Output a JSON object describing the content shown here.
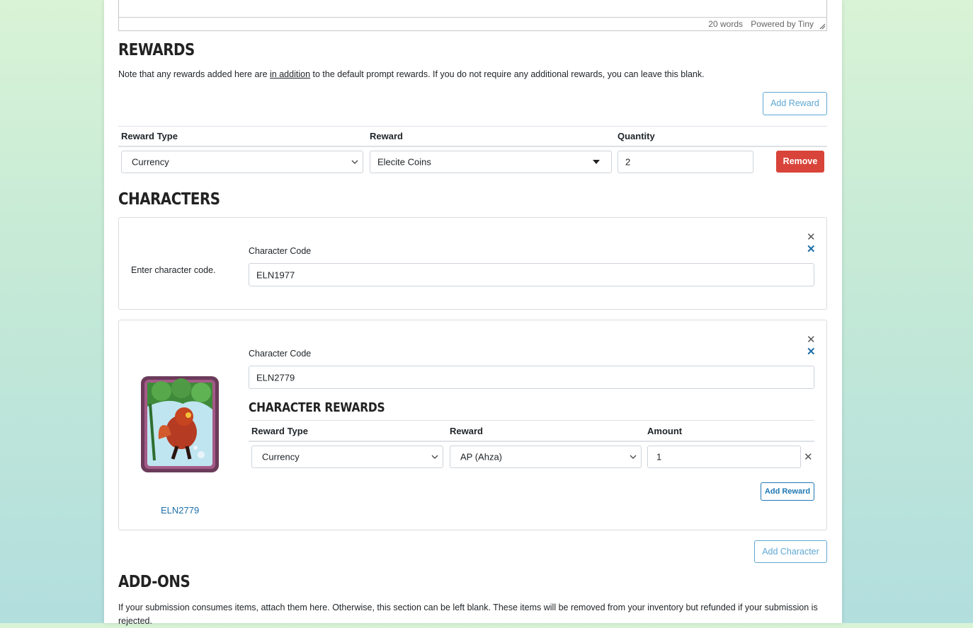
{
  "editor": {
    "word_count": "20 words",
    "powered_by": "Powered by Tiny"
  },
  "rewards": {
    "heading": "REWARDS",
    "note_before": "Note that any rewards added here are ",
    "note_underlined": "in addition",
    "note_after": " to the default prompt rewards. If you do not require any additional rewards, you can leave this blank.",
    "add_button": "Add Reward",
    "columns": [
      "Reward Type",
      "Reward",
      "Quantity"
    ],
    "rows": [
      {
        "type": "Currency",
        "reward": "Elecite Coins",
        "quantity": "2",
        "remove_label": "Remove"
      }
    ]
  },
  "characters": {
    "heading": "CHARACTERS",
    "cards": [
      {
        "placeholder_text": "Enter character code.",
        "code_label": "Character Code",
        "code_value": "ELN1977"
      },
      {
        "thumbnail_link": "ELN2779",
        "code_label": "Character Code",
        "code_value": "ELN2779",
        "rewards_heading": "CHARACTER REWARDS",
        "columns": [
          "Reward Type",
          "Reward",
          "Amount"
        ],
        "rows": [
          {
            "type": "Currency",
            "reward": "AP (Ahza)",
            "amount": "1"
          }
        ],
        "add_reward_button": "Add Reward"
      }
    ],
    "add_character_button": "Add Character"
  },
  "addons": {
    "heading": "ADD-ONS",
    "note": "If your submission consumes items, attach them here. Otherwise, this section can be left blank. These items will be removed from your inventory but refunded if your submission is rejected."
  },
  "colors": {
    "accent": "#5fa8d3",
    "link": "#1e6fa8",
    "danger": "#d9443a"
  }
}
